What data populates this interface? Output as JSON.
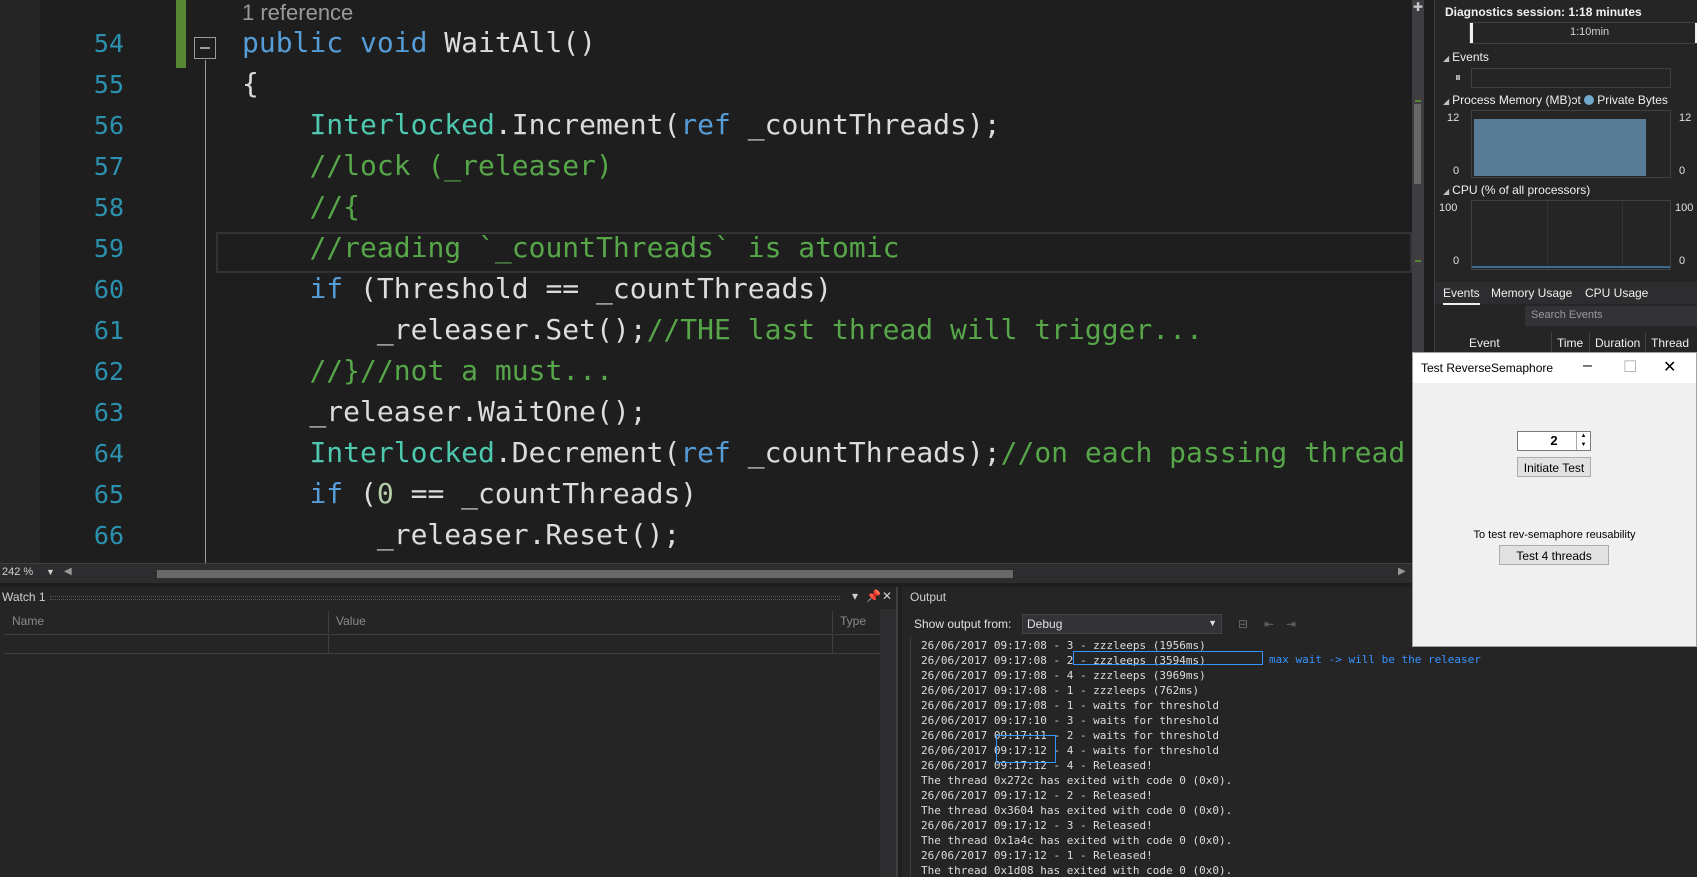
{
  "editor": {
    "reference_lens": "1 reference",
    "zoom": "242 %",
    "lines": [
      {
        "no": "54",
        "tokens": [
          {
            "t": "public",
            "c": "kw"
          },
          {
            "t": " ",
            "c": "pl"
          },
          {
            "t": "void",
            "c": "kw"
          },
          {
            "t": " WaitAll()",
            "c": "pl"
          }
        ]
      },
      {
        "no": "55",
        "tokens": [
          {
            "t": "{",
            "c": "pl"
          }
        ]
      },
      {
        "no": "56",
        "tokens": [
          {
            "t": "    ",
            "c": "pl"
          },
          {
            "t": "Interlocked",
            "c": "ty"
          },
          {
            "t": ".Increment(",
            "c": "pl"
          },
          {
            "t": "ref",
            "c": "kw"
          },
          {
            "t": " _countThreads);",
            "c": "pl"
          }
        ]
      },
      {
        "no": "57",
        "tokens": [
          {
            "t": "    ",
            "c": "pl"
          },
          {
            "t": "//lock (_releaser)",
            "c": "cm"
          }
        ]
      },
      {
        "no": "58",
        "tokens": [
          {
            "t": "    ",
            "c": "pl"
          },
          {
            "t": "//{",
            "c": "cm"
          }
        ]
      },
      {
        "no": "59",
        "tokens": [
          {
            "t": "    ",
            "c": "pl"
          },
          {
            "t": "//reading `_countThreads` is atomic",
            "c": "cm"
          }
        ]
      },
      {
        "no": "60",
        "tokens": [
          {
            "t": "    ",
            "c": "pl"
          },
          {
            "t": "if",
            "c": "kw"
          },
          {
            "t": " (Threshold == _countThreads)",
            "c": "pl"
          }
        ]
      },
      {
        "no": "61",
        "tokens": [
          {
            "t": "        _releaser.Set();",
            "c": "pl"
          },
          {
            "t": "//THE last thread will trigger...",
            "c": "cm"
          }
        ]
      },
      {
        "no": "62",
        "tokens": [
          {
            "t": "    ",
            "c": "pl"
          },
          {
            "t": "//}//not a must...",
            "c": "cm"
          }
        ]
      },
      {
        "no": "63",
        "tokens": [
          {
            "t": "    _releaser.WaitOne();",
            "c": "pl"
          }
        ]
      },
      {
        "no": "64",
        "tokens": [
          {
            "t": "    ",
            "c": "pl"
          },
          {
            "t": "Interlocked",
            "c": "ty"
          },
          {
            "t": ".Decrement(",
            "c": "pl"
          },
          {
            "t": "ref",
            "c": "kw"
          },
          {
            "t": " _countThreads);",
            "c": "pl"
          },
          {
            "t": "//on each passing thread",
            "c": "cm"
          }
        ]
      },
      {
        "no": "65",
        "tokens": [
          {
            "t": "    ",
            "c": "pl"
          },
          {
            "t": "if",
            "c": "kw"
          },
          {
            "t": " (",
            "c": "pl"
          },
          {
            "t": "0",
            "c": "nu"
          },
          {
            "t": " == _countThreads)",
            "c": "pl"
          }
        ]
      },
      {
        "no": "66",
        "tokens": [
          {
            "t": "        _releaser.Reset();",
            "c": "pl"
          }
        ]
      }
    ]
  },
  "watch": {
    "title": "Watch 1",
    "columns": [
      "Name",
      "Value",
      "Type"
    ],
    "pin_icon": "pin-icon",
    "close_icon": "close-icon"
  },
  "output": {
    "title": "Output",
    "source_label": "Show output from:",
    "source_value": "Debug",
    "lines": [
      "26/06/2017 09:17:08 - 3 - zzzleeps (1956ms)",
      "26/06/2017 09:17:08 - 2 - zzzleeps (3594ms)",
      "26/06/2017 09:17:08 - 4 - zzzleeps (3969ms)",
      "26/06/2017 09:17:08 - 1 - zzzleeps (762ms)",
      "26/06/2017 09:17:08 - 1 - waits for threshold",
      "26/06/2017 09:17:10 - 3 - waits for threshold",
      "26/06/2017 09:17:11 - 2 - waits for threshold",
      "26/06/2017 09:17:12 - 4 - waits for threshold",
      "26/06/2017 09:17:12 - 4 - Released!",
      "The thread 0x272c has exited with code 0 (0x0).",
      "26/06/2017 09:17:12 - 2 - Released!",
      "The thread 0x3604 has exited with code 0 (0x0).",
      "26/06/2017 09:17:12 - 3 - Released!",
      "The thread 0x1a4c has exited with code 0 (0x0).",
      "26/06/2017 09:17:12 - 1 - Released!",
      "The thread 0x1d08 has exited with code 0 (0x0)."
    ],
    "annotation": "max wait -> will be the releaser"
  },
  "diagnostics": {
    "title": "Diagnostics session: 1:18 minutes",
    "timeline_label": "1:10min",
    "timeline_label2": "1:",
    "events_header": "Events",
    "memory_header": "Process Memory (MB)",
    "memory_legend_suffix": "ɔt",
    "memory_legend": "Private Bytes",
    "memory_max": "12",
    "memory_min": "0",
    "cpu_header": "CPU (% of all processors)",
    "cpu_max": "100",
    "cpu_min": "0",
    "tabs": [
      "Events",
      "Memory Usage",
      "CPU Usage"
    ],
    "search_placeholder": "Search Events",
    "grid_columns": [
      "Event",
      "Time",
      "Duration",
      "Thread"
    ]
  },
  "dialog": {
    "title": "Test ReverseSemaphore",
    "spinner_value": "2",
    "initiate_button": "Initiate Test",
    "reuse_label": "To test rev-semaphore reusability",
    "test4_button": "Test 4 threads"
  }
}
